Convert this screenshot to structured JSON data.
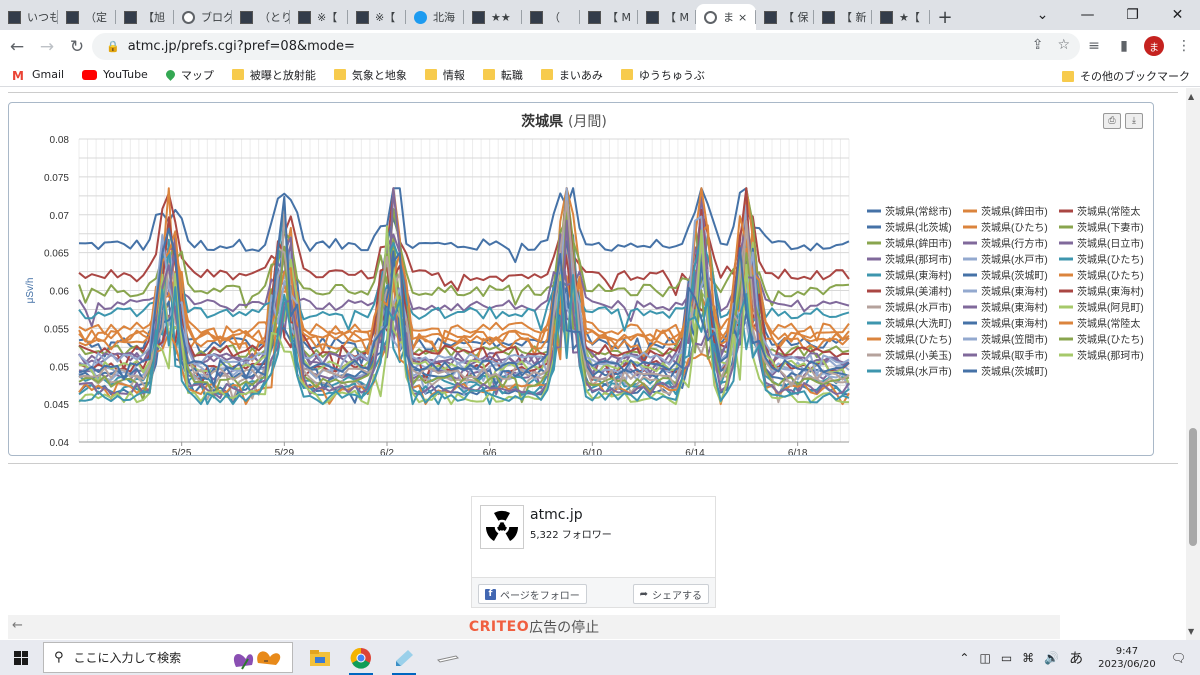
{
  "browser": {
    "tabs": [
      {
        "label": "いつも",
        "icon": "site-icon"
      },
      {
        "label": "（定",
        "icon": "site-icon"
      },
      {
        "label": "【旭",
        "icon": "site-icon"
      },
      {
        "label": "ブログ",
        "icon": "info-icon"
      },
      {
        "label": "（とり",
        "icon": "site-icon"
      },
      {
        "label": "※【",
        "icon": "site-icon"
      },
      {
        "label": "※【",
        "icon": "site-icon"
      },
      {
        "label": "北海",
        "icon": "twitter-icon"
      },
      {
        "label": "★★",
        "icon": "site-icon"
      },
      {
        "label": "（",
        "icon": "site-icon"
      },
      {
        "label": "【 M",
        "icon": "site-icon"
      },
      {
        "label": "【 M",
        "icon": "site-icon"
      },
      {
        "label": "ま",
        "icon": "globe-icon",
        "active": true,
        "close": "×"
      },
      {
        "label": "【 保",
        "icon": "site-icon"
      },
      {
        "label": "【 新",
        "icon": "site-icon"
      },
      {
        "label": "★【",
        "icon": "site-icon"
      }
    ],
    "new_tab": "+",
    "url": "atmc.jp/prefs.cgi?pref=08&mode=",
    "bookmarks": [
      {
        "label": "Gmail",
        "icon": "gmail-icon"
      },
      {
        "label": "YouTube",
        "icon": "youtube-icon"
      },
      {
        "label": "マップ",
        "icon": "maps-icon"
      },
      {
        "label": "被曝と放射能",
        "icon": "folder-icon"
      },
      {
        "label": "気象と地象",
        "icon": "folder-icon"
      },
      {
        "label": "情報",
        "icon": "folder-icon"
      },
      {
        "label": "転職",
        "icon": "folder-icon"
      },
      {
        "label": "まいあみ",
        "icon": "folder-icon"
      },
      {
        "label": "ゆうちゅうぶ",
        "icon": "folder-icon"
      }
    ],
    "other_bookmarks": "その他のブックマーク",
    "avatar_letter": "ま"
  },
  "chart_data": {
    "type": "line",
    "title": "茨城県",
    "subtitle": "(月間)",
    "ylabel": "μSv/h",
    "ylim": [
      0.04,
      0.08
    ],
    "yticks": [
      "0.08",
      "0.075",
      "0.07",
      "0.065",
      "0.06",
      "0.055",
      "0.05",
      "0.045",
      "0.04"
    ],
    "xticks": [
      "5/25",
      "5/29",
      "6/2",
      "6/6",
      "6/10",
      "6/14",
      "6/18"
    ],
    "x_range": [
      "5/21",
      "6/20"
    ],
    "grid": true,
    "legend_position": "right",
    "spike_days": [
      3.5,
      8.0,
      12.2,
      19.0,
      24.2,
      26.0
    ],
    "series": [
      {
        "name": "茨城県(常総市)",
        "color": "#4572a7",
        "base": 0.066
      },
      {
        "name": "茨城県(鉾田市)",
        "color": "#db843d",
        "base": 0.055
      },
      {
        "name": "茨城県(常陸太",
        "color": "#aa4643",
        "base": 0.062
      },
      {
        "name": "茨城県(北茨城)",
        "color": "#4572a7",
        "base": 0.053
      },
      {
        "name": "茨城県(ひたち)",
        "color": "#db843d",
        "base": 0.054
      },
      {
        "name": "茨城県(下妻市)",
        "color": "#89a54e",
        "base": 0.06
      },
      {
        "name": "茨城県(鉾田市)",
        "color": "#89a54e",
        "base": 0.052
      },
      {
        "name": "茨城県(行方市)",
        "color": "#80699b",
        "base": 0.049
      },
      {
        "name": "茨城県(日立市)",
        "color": "#80699b",
        "base": 0.058
      },
      {
        "name": "茨城県(那珂市)",
        "color": "#80699b",
        "base": 0.051
      },
      {
        "name": "茨城県(水戸市)",
        "color": "#93a9cf",
        "base": 0.05
      },
      {
        "name": "茨城県(ひたち)",
        "color": "#3d96ae",
        "base": 0.057
      },
      {
        "name": "茨城県(東海村)",
        "color": "#3d96ae",
        "base": 0.048
      },
      {
        "name": "茨城県(茨城町)",
        "color": "#4572a7",
        "base": 0.047
      },
      {
        "name": "茨城県(ひたち)",
        "color": "#db843d",
        "base": 0.053
      },
      {
        "name": "茨城県(美浦村)",
        "color": "#aa4643",
        "base": 0.05
      },
      {
        "name": "茨城県(東海村)",
        "color": "#93a9cf",
        "base": 0.049
      },
      {
        "name": "茨城県(東海村)",
        "color": "#aa4643",
        "base": 0.052
      },
      {
        "name": "茨城県(水戸市)",
        "color": "#b5a29c",
        "base": 0.048
      },
      {
        "name": "茨城県(東海村)",
        "color": "#80699b",
        "base": 0.051
      },
      {
        "name": "茨城県(阿見町)",
        "color": "#a6c96a",
        "base": 0.05
      },
      {
        "name": "茨城県(大洗町)",
        "color": "#3d96ae",
        "base": 0.047
      },
      {
        "name": "茨城県(東海村)",
        "color": "#4572a7",
        "base": 0.049
      },
      {
        "name": "茨城県(常陸太",
        "color": "#db843d",
        "base": 0.054
      },
      {
        "name": "茨城県(ひたち)",
        "color": "#db843d",
        "base": 0.047
      },
      {
        "name": "茨城県(笠間市)",
        "color": "#93a9cf",
        "base": 0.051
      },
      {
        "name": "茨城県(ひたち)",
        "color": "#89a54e",
        "base": 0.048
      },
      {
        "name": "茨城県(小美玉)",
        "color": "#b5a29c",
        "base": 0.049
      },
      {
        "name": "茨城県(取手市)",
        "color": "#80699b",
        "base": 0.047
      },
      {
        "name": "茨城県(那珂市)",
        "color": "#a6c96a",
        "base": 0.046
      },
      {
        "name": "茨城県(水戸市)",
        "color": "#3d96ae",
        "base": 0.046
      },
      {
        "name": "茨城県(茨城町)",
        "color": "#4572a7",
        "base": 0.05
      }
    ]
  },
  "facebook": {
    "name": "atmc.jp",
    "followers": "5,322 フォロワー",
    "follow_button": "ページをフォロー",
    "share_button": "シェアする"
  },
  "ad": {
    "brand": "CRITEO",
    "text": "広告の停止"
  },
  "taskbar": {
    "search_placeholder": "ここに入力して検索",
    "time": "9:47",
    "date": "2023/06/20",
    "ime": "あ"
  }
}
